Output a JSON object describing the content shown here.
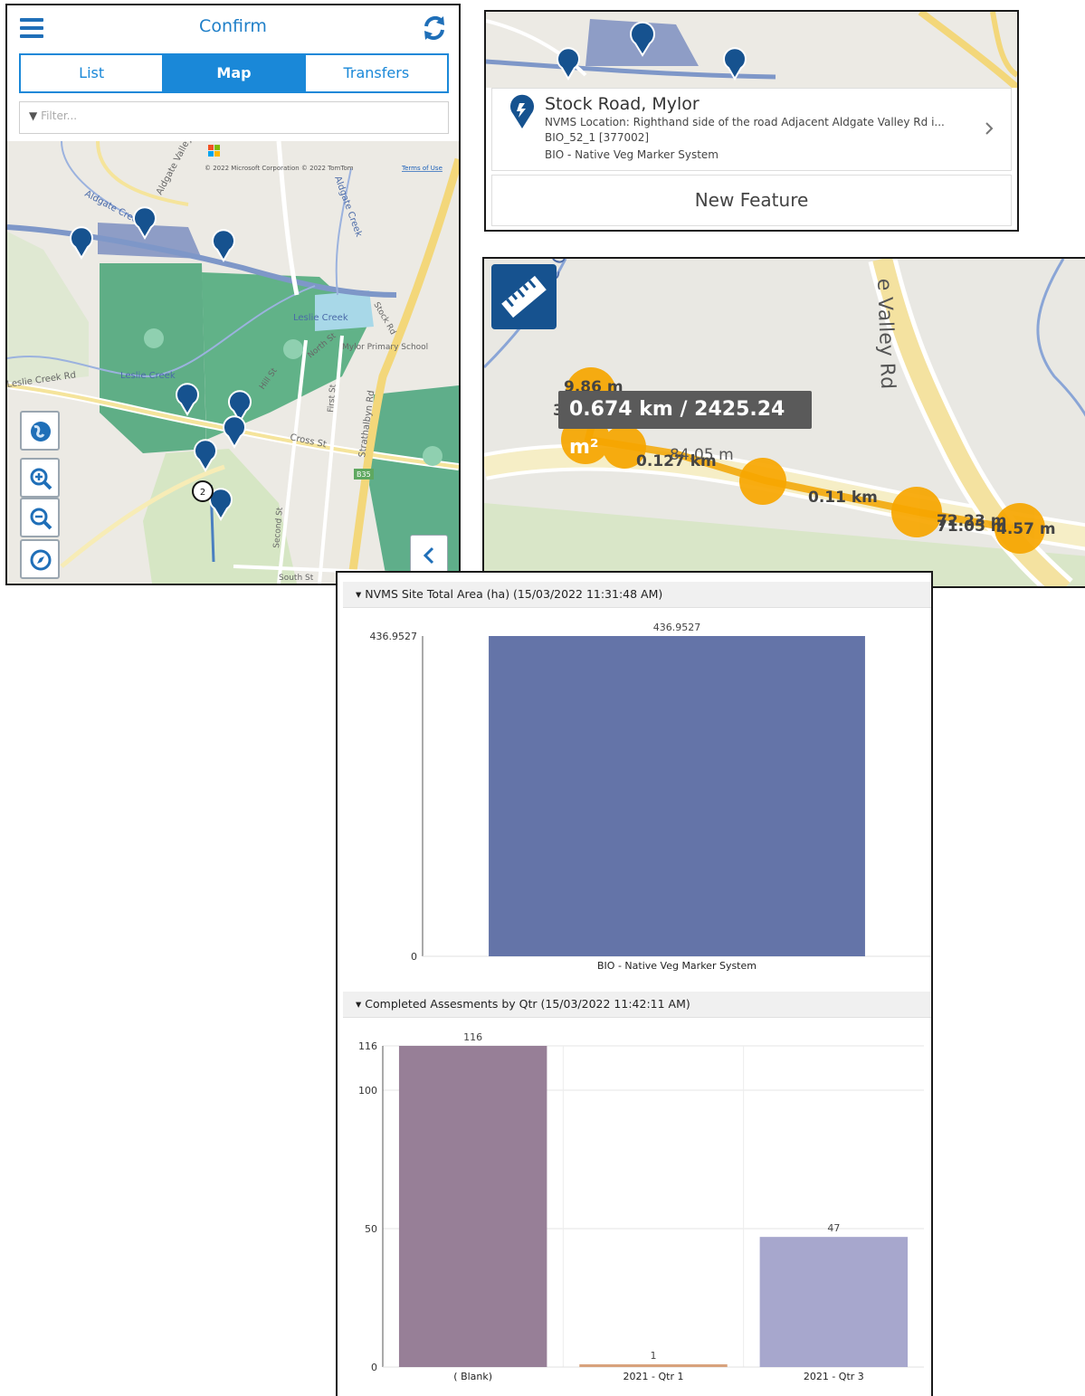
{
  "app": {
    "title": "Confirm",
    "tabs": [
      {
        "label": "List",
        "active": false
      },
      {
        "label": "Map",
        "active": true
      },
      {
        "label": "Transfers",
        "active": false
      }
    ],
    "filter_placeholder": "Filter...",
    "map_attribution": "© 2022 Microsoft Corporation © 2022 TomTom",
    "map_attribution_link": "Terms of Use",
    "map_labels": {
      "aldgate_creek": "Aldgate Creek",
      "aldgate_valley": "Aldgate Valley",
      "aldgate_creek_v": "Aldgate Creek",
      "leslie_creek": "Leslie Creek",
      "leslie_creek_2": "Leslie Creek",
      "leslie_creek_rd": "Leslie Creek Rd",
      "cross_st": "Cross St",
      "first_st": "First St",
      "second_st": "Second St",
      "north_st": "North St",
      "strathalbyn_rd": "Strathalbyn Rd",
      "school": "Mylor Primary School",
      "stock_rd": "Stock Rd",
      "south_st": "South St",
      "hill_st": "Hill St",
      "cluster_count": "2",
      "route_badge": "B35"
    },
    "colors": {
      "accent": "#1a88d8",
      "header_text": "#1f7fc8",
      "marker": "#16528f"
    }
  },
  "feature_card": {
    "title": "Stock Road, Mylor",
    "location": "NVMS Location: Righthand side of the road Adjacent Aldgate Valley Rd i...",
    "id": "BIO_52_1 [377002]",
    "type": "BIO - Native Veg Marker System",
    "new_feature_label": "New Feature"
  },
  "measure": {
    "total": "0.674 km / 2425.24 m²",
    "segment_labels": [
      "9.86 m",
      "0.127 km",
      "84.05 m",
      "0.11 km",
      "72.23 m",
      "71.05 m",
      "4.57 m"
    ],
    "overlap_label": "36",
    "road_label": "e Valley Rd",
    "creek_label": "e C"
  },
  "charts": {
    "area": {
      "header": "NVMS Site Total Area (ha) (15/03/2022 11:31:48 AM)"
    },
    "assessments": {
      "header": "Completed Assesments by Qtr (15/03/2022 11:42:11 AM)"
    }
  },
  "chart_data": [
    {
      "type": "bar",
      "title": "NVMS Site Total Area (ha) (15/03/2022 11:31:48 AM)",
      "categories": [
        "BIO - Native Veg Marker System"
      ],
      "values": [
        436.9527
      ],
      "data_labels": [
        "436.9527"
      ],
      "ylim": [
        0,
        436.9527
      ],
      "yticks": [
        "0",
        "436.9527"
      ],
      "colors": [
        "#6474a8"
      ],
      "grid": false
    },
    {
      "type": "bar",
      "title": "Completed Assesments by Qtr (15/03/2022 11:42:11 AM)",
      "categories": [
        "( Blank)",
        "2021 - Qtr 1",
        "2021 - Qtr 3"
      ],
      "values": [
        116,
        1,
        47
      ],
      "data_labels": [
        "116",
        "1",
        "47"
      ],
      "ylim": [
        0,
        116
      ],
      "yticks": [
        "0",
        "50",
        "100",
        "116"
      ],
      "colors": [
        "#977f97",
        "#d8a27c",
        "#a7a7cd"
      ],
      "grid": true
    }
  ]
}
